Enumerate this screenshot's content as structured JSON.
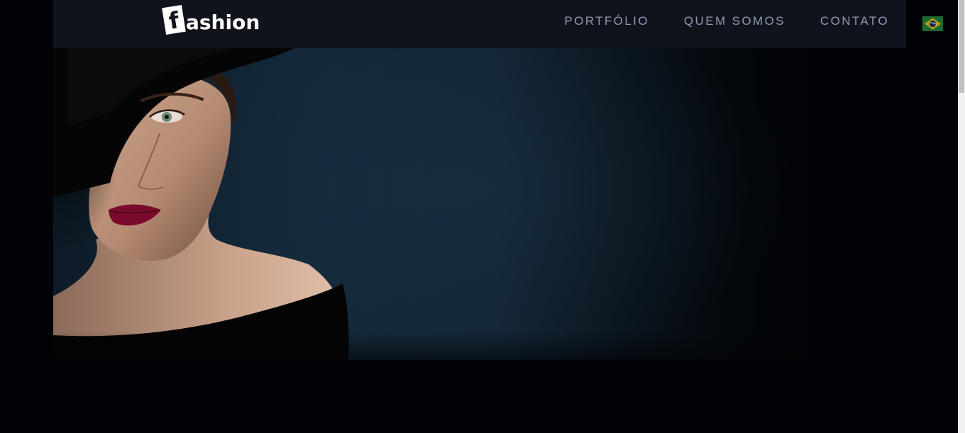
{
  "header": {
    "logo_letter": "f",
    "logo_rest": "ashion",
    "logo_alt": "fashion",
    "nav": [
      {
        "label": "PORTFÓLIO"
      },
      {
        "label": "QUEM SOMOS"
      },
      {
        "label": "CONTATO"
      }
    ],
    "language_flag": "brazil-flag-icon"
  },
  "hero": {
    "image": "hero-image",
    "subject": "woman-in-black-hat"
  },
  "colors": {
    "page_background": "#020306",
    "header_background": "#10131b",
    "nav_text": "#8f9bb8",
    "logo_text": "#ffffff",
    "hero_background": "#14293a",
    "lips": "#7a0a2c"
  }
}
